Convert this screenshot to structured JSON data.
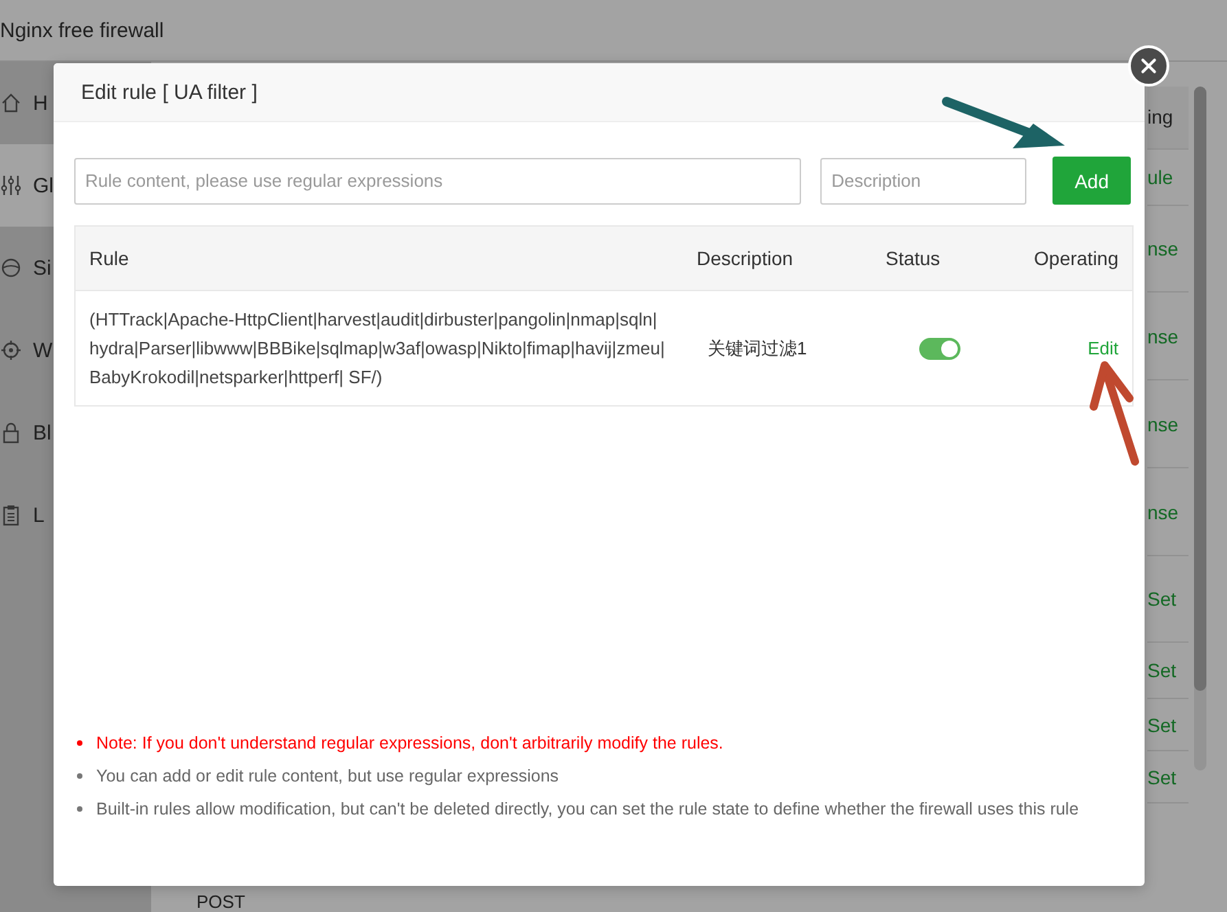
{
  "app": {
    "title": "Nginx free firewall",
    "sidebar": {
      "items": [
        {
          "label": "H",
          "selected": false
        },
        {
          "label": "Gl",
          "selected": true
        },
        {
          "label": "Si",
          "selected": false
        },
        {
          "label": "W",
          "selected": false
        },
        {
          "label": "Bl",
          "selected": false
        },
        {
          "label": "L",
          "selected": false
        }
      ]
    },
    "table_edge": {
      "header": "ing",
      "cells": [
        "ule",
        "nse",
        "nse",
        "nse",
        "nse",
        "Set",
        "Set",
        "Set",
        "Set"
      ]
    },
    "footer": {
      "text": "POST"
    }
  },
  "dialog": {
    "title": "Edit rule [ UA filter ]",
    "rule_field": {
      "placeholder": "Rule content, please use regular expressions"
    },
    "description_field": {
      "placeholder": "Description"
    },
    "add_button": "Add",
    "table": {
      "columns": [
        "Rule",
        "Description",
        "Status",
        "Operating"
      ],
      "rows": [
        {
          "rule": "(HTTrack|Apache-HttpClient|harvest|audit|dirbuster|pangolin|nmap|sqln|hydra|Parser|libwww|BBBike|sqlmap|w3af|owasp|Nikto|fimap|havij|zmeu|BabyKrokodil|netsparker|httperf| SF/)",
          "description": "关键词过滤1",
          "on": true,
          "action": "Edit"
        }
      ]
    },
    "notes": [
      {
        "kind": "warning",
        "text": "Note: If you don't understand regular expressions, don't arbitrarily modify the rules."
      },
      {
        "kind": "info",
        "text": "You can add or edit rule content, but use regular expressions"
      },
      {
        "kind": "info",
        "text": "Built-in rules allow modification, but can't be deleted directly, you can set the rule state to define whether the firewall uses this rule"
      }
    ]
  }
}
